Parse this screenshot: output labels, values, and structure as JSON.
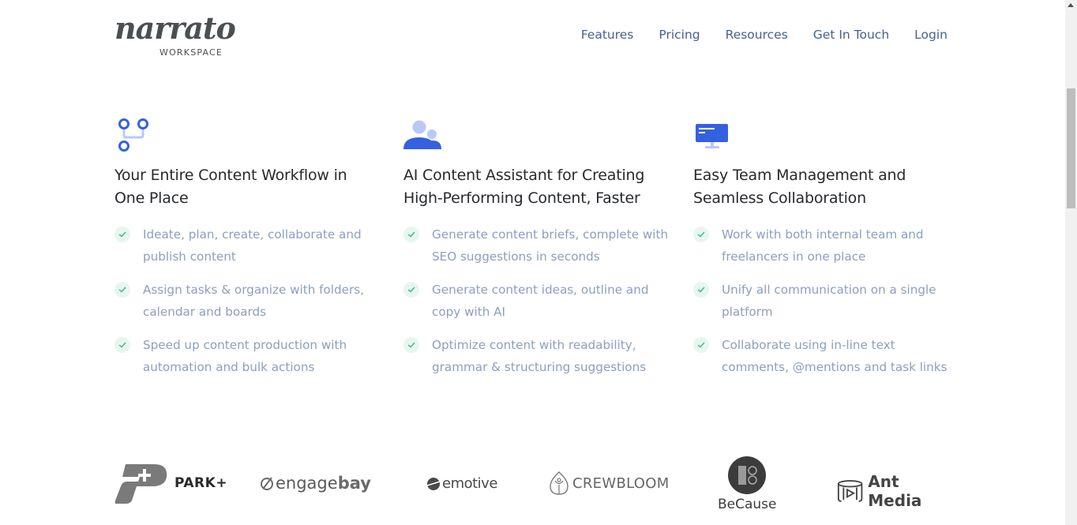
{
  "header": {
    "logo": {
      "name": "narrato",
      "tagline": "WORKSPACE"
    },
    "nav": [
      {
        "label": "Features"
      },
      {
        "label": "Pricing"
      },
      {
        "label": "Resources"
      },
      {
        "label": "Get In Touch"
      },
      {
        "label": "Login"
      }
    ]
  },
  "features": [
    {
      "icon": "workflow-branch-icon",
      "title_line1": "Your Entire Content Workflow in",
      "title_line2": "One Place",
      "items": [
        "Ideate, plan, create, collaborate and publish content",
        "Assign tasks & organize with folders, calendar and boards",
        "Speed up content production with automation and bulk actions"
      ]
    },
    {
      "icon": "team-users-icon",
      "title_line1": "AI Content Assistant for Creating",
      "title_line2": "High-Performing Content, Faster",
      "items": [
        "Generate content briefs, complete with SEO suggestions in seconds",
        "Generate content ideas, outline and copy with AI",
        "Optimize content with readability, grammar & structuring suggestions"
      ]
    },
    {
      "icon": "monitor-icon",
      "title_line1": "Easy Team Management and",
      "title_line2": "Seamless Collaboration",
      "items": [
        "Work with both internal team and freelancers in one place",
        "Unify all communication on a single platform",
        "Collaborate using in-line text comments, @mentions and task links"
      ]
    }
  ],
  "customer_logos": {
    "park": "PARK+",
    "engagebay_a": "engage",
    "engagebay_b": "bay",
    "emotive": "emotive",
    "crewbloom": "CREWBLOOM",
    "because": "BeCause",
    "antmedia": "Ant Media"
  },
  "colors": {
    "accent_blue": "#3461e0",
    "accent_light_blue": "#b9c9f5",
    "nav_text": "#44618f",
    "body_text": "#8c9fbe",
    "check_green": "#3bb98a",
    "check_bg": "#e8f6f0"
  }
}
